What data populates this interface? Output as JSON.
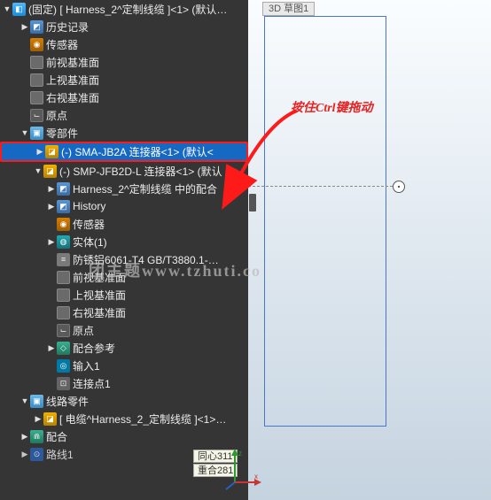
{
  "rootLabel": "(固定) [ Harness_2^定制线缆 ]<1> (默认…",
  "annotation": "按住Ctrl键拖动",
  "sketchTab": "3D 草图1",
  "tooltip1": "同心311",
  "tooltip2": "重合281",
  "watermark": "团主题www.tzhuti.co",
  "tree": {
    "history": "历史记录",
    "sensor": "传感器",
    "frontPlane": "前视基准面",
    "topPlane": "上视基准面",
    "rightPlane": "右视基准面",
    "origin": "原点",
    "components": "零部件",
    "sma": "(-) SMA-JB2A 连接器<1> (默认<",
    "smp": "(-) SMP-JFB2D-L 连接器<1> (默认",
    "harnessCfg": "Harness_2^定制线缆 中的配合",
    "historyEn": "History",
    "sensor2": "传感器",
    "solid": "实体(1)",
    "material": "防锈铝6061-T4  GB/T3880.1-…",
    "frontPlane2": "前视基准面",
    "topPlane2": "上视基准面",
    "rightPlane2": "右视基准面",
    "origin2": "原点",
    "mateRef": "配合参考",
    "input1": "输入1",
    "connPt": "连接点1",
    "routeParts": "线路零件",
    "cable": "[ 电缆^Harness_2_定制线缆 ]<1>…",
    "mates": "配合",
    "route1": "路线1"
  }
}
